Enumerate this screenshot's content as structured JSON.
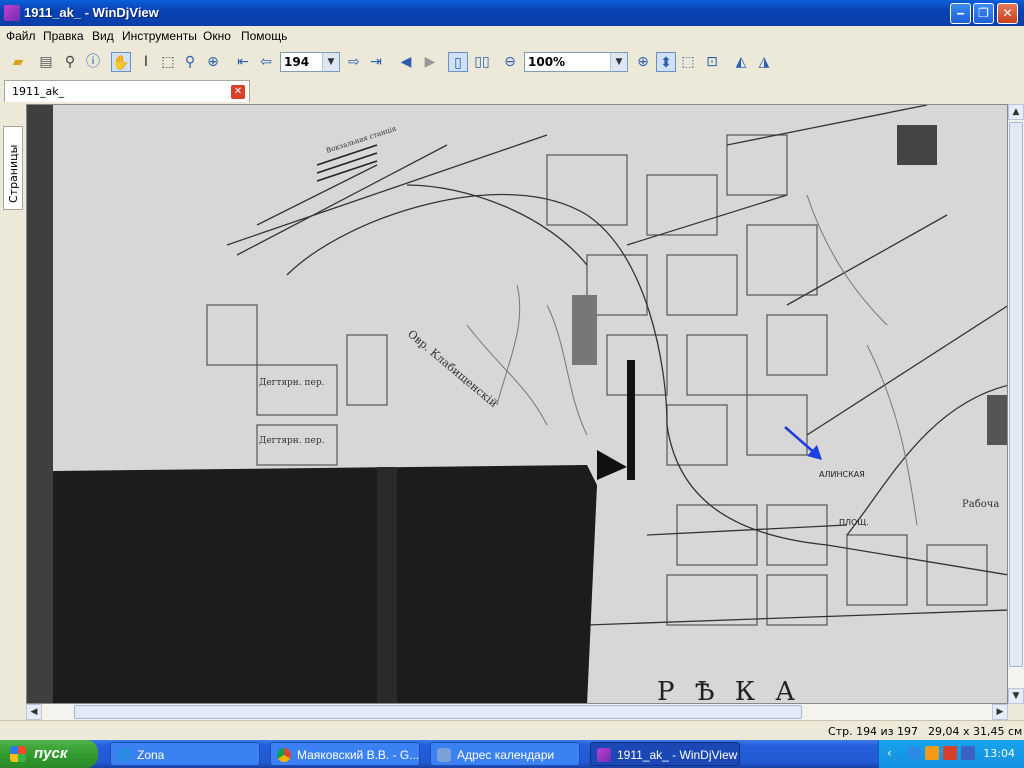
{
  "window": {
    "title": "1911_ak_ - WinDjView",
    "minimize": "‒",
    "maximize": "❐",
    "close": "✕"
  },
  "menu": [
    "Файл",
    "Правка",
    "Вид",
    "Инструменты",
    "Окно",
    "Помощь"
  ],
  "toolbar": {
    "page_value": "194",
    "zoom_value": "100%"
  },
  "tab": {
    "label": "1911_ak_"
  },
  "sidebar": {
    "tab_label": "Страницы"
  },
  "map": {
    "labels": {
      "big": "Р Ѣ К А",
      "ovrag": "Овр. Клабищенскій",
      "degtyarny1": "Дегтярн. пер.",
      "degtyarny2": "Дегтярн. пер.",
      "square1": "АЛИНСКАЯ",
      "square2": "ПЛОЩ.",
      "vokzal": "Вокзальная станція",
      "rabochaya": "Рабоча"
    }
  },
  "status": {
    "page": "Стр. 194 из 197",
    "size": "29,04 x 31,45 см"
  },
  "taskbar": {
    "start": "пуск",
    "tasks": [
      "Zona",
      "Маяковский В.В. - G...",
      "Адрес календари",
      "1911_ak_ - WinDjView"
    ],
    "time": "13:04"
  }
}
